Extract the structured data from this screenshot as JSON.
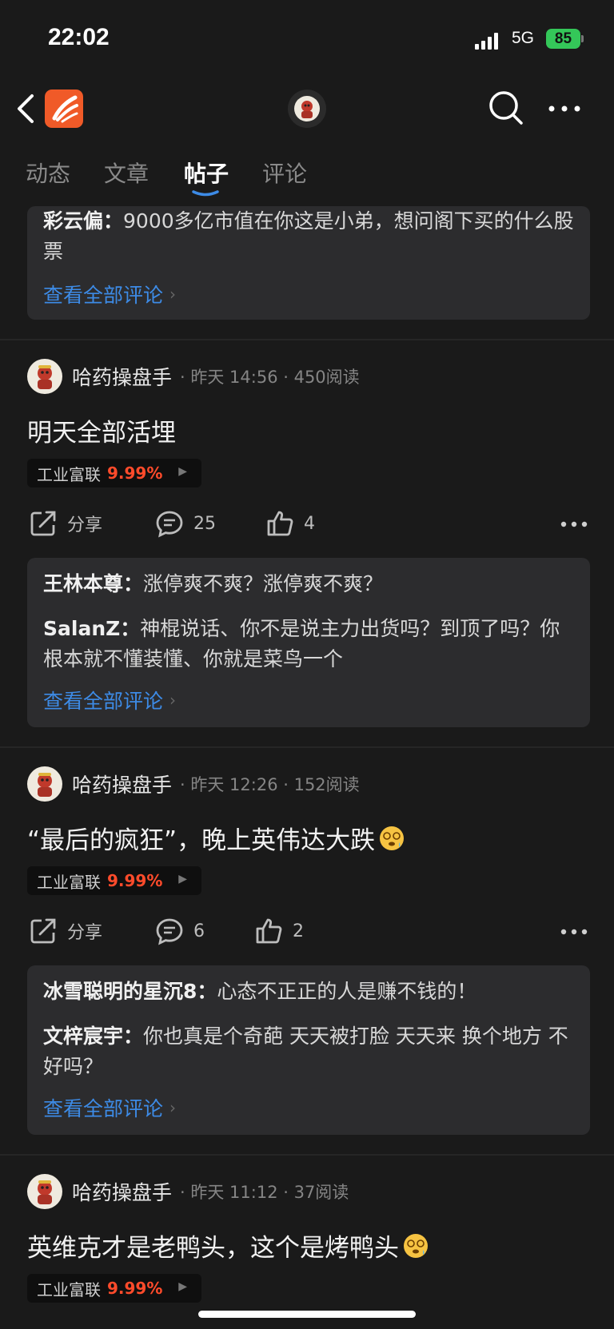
{
  "status": {
    "time": "22:02",
    "network": "5G",
    "battery": "85"
  },
  "tabs": [
    {
      "label": "动态"
    },
    {
      "label": "文章"
    },
    {
      "label": "帖子"
    },
    {
      "label": "评论"
    }
  ],
  "top_comment_box": {
    "comment_user": "彩云偏：",
    "comment_text": "9000多亿市值在你这是小弟，想问阁下买的什么股票",
    "view_all": "查看全部评论"
  },
  "posts": [
    {
      "author": "哈药操盘手",
      "meta": "· 昨天 14:56 · 450阅读",
      "title": "明天全部活埋",
      "stock_name": "工业富联",
      "stock_pct": "9.99%",
      "share_label": "分享",
      "comments_count": "25",
      "likes_count": "4",
      "comments": [
        {
          "user": "王林本尊：",
          "text": "涨停爽不爽？涨停爽不爽？"
        },
        {
          "user": "SalanZ：",
          "text": "神棍说话、你不是说主力出货吗？到顶了吗？你根本就不懂装懂、你就是菜鸟一个"
        }
      ],
      "view_all": "查看全部评论"
    },
    {
      "author": "哈药操盘手",
      "meta": "· 昨天 12:26 · 152阅读",
      "title": "“最后的疯狂”，晚上英伟达大跌",
      "stock_name": "工业富联",
      "stock_pct": "9.99%",
      "share_label": "分享",
      "comments_count": "6",
      "likes_count": "2",
      "comments": [
        {
          "user": "冰雪聪明的星沉8：",
          "text": "心态不正正的人是赚不钱的！"
        },
        {
          "user": "文梓宸宇：",
          "text": "你也真是个奇葩 天天被打脸 天天来 换个地方 不好吗？"
        }
      ],
      "view_all": "查看全部评论"
    },
    {
      "author": "哈药操盘手",
      "meta": "· 昨天 11:12 · 37阅读",
      "title": "英维克才是老鸭头，这个是烤鸭头",
      "stock_name": "工业富联",
      "stock_pct": "9.99%"
    }
  ],
  "colors": {
    "accent_blue": "#3d8be6",
    "stock_up": "#ff4b2b",
    "logo_orange": "#f05a28"
  }
}
